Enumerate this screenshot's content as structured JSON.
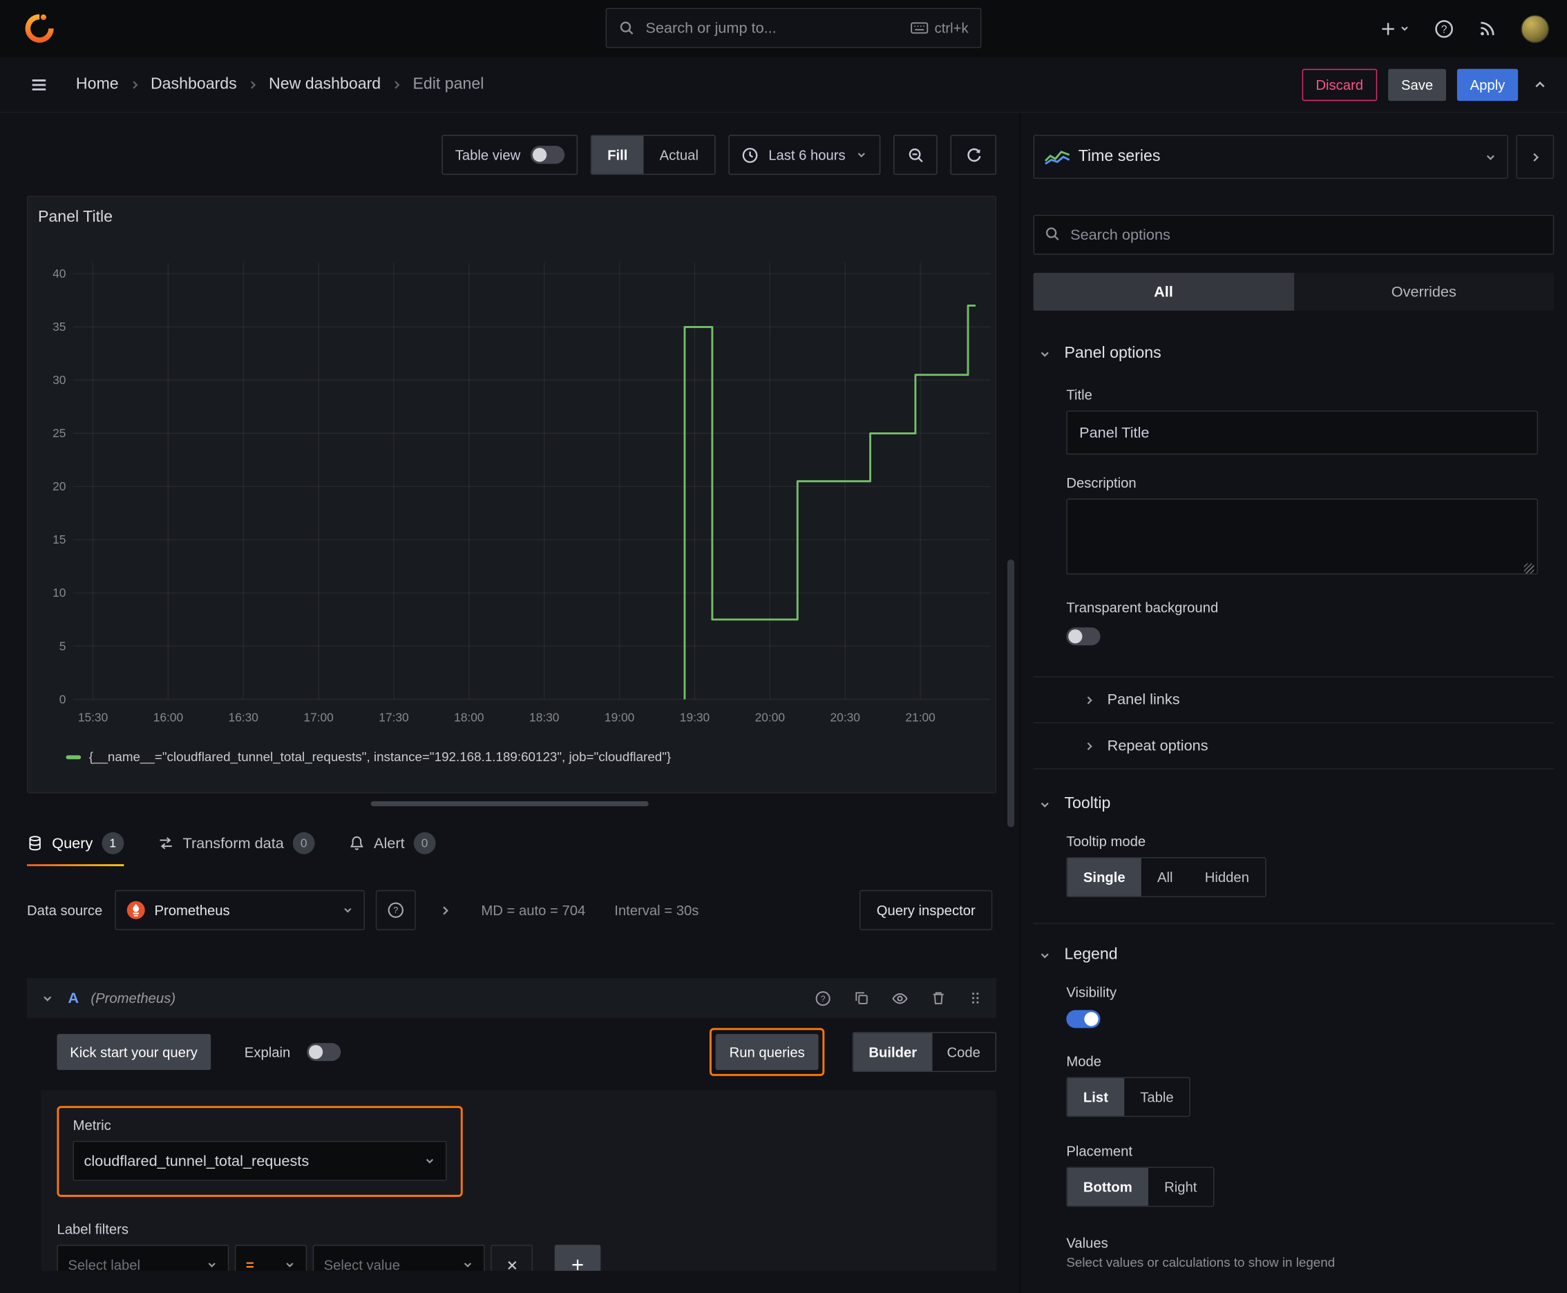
{
  "colors": {
    "accent_orange": "#ff780a",
    "series_green": "#73bf69",
    "primary_blue": "#3d71d9",
    "danger_red": "#ff5286"
  },
  "icons": {
    "topbar": [
      "grafana-logo",
      "search-icon",
      "keyboard-icon",
      "plus-icon",
      "caret-down-icon",
      "help-icon",
      "news-icon",
      "avatar"
    ],
    "misc": [
      "clock-icon",
      "zoom-out-icon",
      "refresh-icon",
      "database-icon",
      "transform-icon",
      "bell-icon",
      "prometheus-icon",
      "copy-icon",
      "eye-icon",
      "trash-icon",
      "grip-icon",
      "close-icon"
    ]
  },
  "topbar": {
    "search_placeholder": "Search or jump to...",
    "shortcut": "ctrl+k"
  },
  "breadcrumb": {
    "items": [
      "Home",
      "Dashboards",
      "New dashboard",
      "Edit panel"
    ],
    "discard": "Discard",
    "save": "Save",
    "apply": "Apply"
  },
  "toolbar": {
    "table_view": "Table view",
    "fill": "Fill",
    "actual": "Actual",
    "time_range": "Last 6 hours"
  },
  "panel": {
    "title": "Panel Title"
  },
  "chart_data": {
    "type": "line",
    "line_style": "step-after",
    "title": "Panel Title",
    "x_ticks": [
      "15:30",
      "16:00",
      "16:30",
      "17:00",
      "17:30",
      "18:00",
      "18:30",
      "19:00",
      "19:30",
      "20:00",
      "20:30",
      "21:00"
    ],
    "x_tick_minutes": [
      0,
      30,
      60,
      90,
      120,
      150,
      180,
      210,
      240,
      270,
      300,
      330
    ],
    "x_range_minutes": [
      -8,
      358
    ],
    "y_ticks": [
      0,
      5,
      10,
      15,
      20,
      25,
      30,
      35,
      40
    ],
    "ylim": [
      0,
      41
    ],
    "grid": true,
    "legend_position": "bottom",
    "series": [
      {
        "name": "{__name__=\"cloudflared_tunnel_total_requests\", instance=\"192.168.1.189:60123\", job=\"cloudflared\"}",
        "color": "#73bf69",
        "points_min_after_1530": [
          [
            236,
            0
          ],
          [
            236,
            35
          ],
          [
            247,
            35
          ],
          [
            247,
            7.5
          ],
          [
            281,
            7.5
          ],
          [
            281,
            20.5
          ],
          [
            310,
            20.5
          ],
          [
            310,
            25
          ],
          [
            328,
            25
          ],
          [
            328,
            30.5
          ],
          [
            349,
            30.5
          ],
          [
            349,
            37
          ],
          [
            352,
            37
          ]
        ]
      }
    ]
  },
  "tabs": {
    "query": "Query",
    "query_count": "1",
    "transform": "Transform data",
    "transform_count": "0",
    "alert": "Alert",
    "alert_count": "0"
  },
  "query": {
    "datasource_label": "Data source",
    "datasource": "Prometheus",
    "stats_md": "MD = auto = 704",
    "stats_interval": "Interval = 30s",
    "inspector": "Query inspector",
    "ref_id": "A",
    "ref_ds": "(Prometheus)",
    "kick_start": "Kick start your query",
    "explain": "Explain",
    "run_queries": "Run queries",
    "builder": "Builder",
    "code": "Code",
    "metric_label": "Metric",
    "metric_value": "cloudflared_tunnel_total_requests",
    "label_filters": "Label filters",
    "select_label": "Select label",
    "op": "=",
    "select_value": "Select value"
  },
  "sidebar": {
    "viz_type": "Time series",
    "search_placeholder": "Search options",
    "seg_all": "All",
    "seg_overrides": "Overrides",
    "panel_options": {
      "title": "Panel options",
      "title_label": "Title",
      "title_value": "Panel Title",
      "description_label": "Description",
      "transparent_label": "Transparent background",
      "panel_links": "Panel links",
      "repeat_options": "Repeat options"
    },
    "tooltip": {
      "title": "Tooltip",
      "mode_label": "Tooltip mode",
      "options": [
        "Single",
        "All",
        "Hidden"
      ]
    },
    "legend": {
      "title": "Legend",
      "visibility_label": "Visibility",
      "mode_label": "Mode",
      "mode_options": [
        "List",
        "Table"
      ],
      "placement_label": "Placement",
      "placement_options": [
        "Bottom",
        "Right"
      ],
      "values_label": "Values",
      "values_desc": "Select values or calculations to show in legend"
    }
  }
}
